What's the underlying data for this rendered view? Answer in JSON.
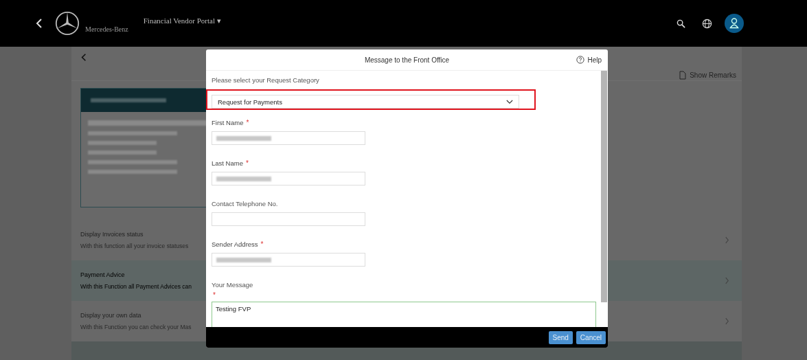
{
  "header": {
    "brand": "Mercedes-Benz",
    "portal": "Financial Vendor Portal ▾"
  },
  "page": {
    "show_remarks": "Show Remarks",
    "functions": [
      {
        "title": "Display Invoices status",
        "description": "With this function all your invoice statuses",
        "selected": false
      },
      {
        "title": "Payment Advice",
        "description": "With this Function all Payment Advices can",
        "selected": true
      },
      {
        "title": "Display your own data",
        "description": "With this Function you can check your Mas",
        "selected": false
      }
    ]
  },
  "dialog": {
    "title": "Message to the Front Office",
    "help": "Help",
    "required_marker": "*",
    "category_label": "Please select your Request Category",
    "category": {
      "value": "Request for Payments",
      "highlighted": true
    },
    "fields": [
      {
        "label": "First Name",
        "required": true,
        "redacted": true
      },
      {
        "label": "Last Name",
        "required": true,
        "redacted": true
      },
      {
        "label": "Contact Telephone No.",
        "required": false,
        "redacted": false
      },
      {
        "label": "Sender Address",
        "required": true,
        "redacted": true
      }
    ],
    "message": {
      "label": "Your Message",
      "required": true,
      "value": "Testing FVP",
      "focused": true
    },
    "buttons": [
      "Send",
      "Cancel"
    ]
  }
}
